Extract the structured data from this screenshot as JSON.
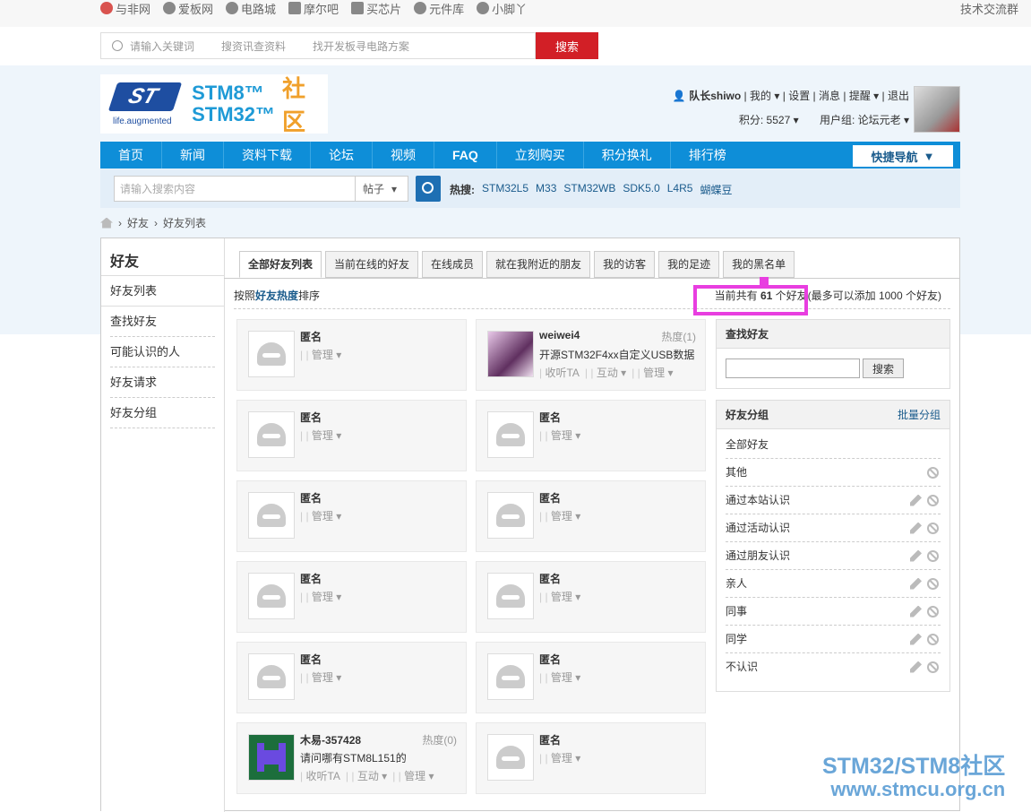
{
  "top_links": [
    "与非网",
    "爱板网",
    "电路城",
    "摩尔吧",
    "买芯片",
    "元件库",
    "小脚丫"
  ],
  "top_right": "技术交流群",
  "search": {
    "placeholders": [
      "请输入关键词",
      "搜资讯查资料",
      "找开发板寻电路方案"
    ],
    "button": "搜索"
  },
  "logo": {
    "tagline": "life.augmented",
    "line1": "STM8™",
    "line2": "STM32™",
    "cn": "社区"
  },
  "user": {
    "name": "队长shiwo",
    "links": [
      "我的",
      "设置",
      "消息",
      "提醒",
      "退出"
    ],
    "points": "积分: 5527",
    "group": "用户组: 论坛元老"
  },
  "nav": {
    "items": [
      "首页",
      "新闻",
      "资料下载",
      "论坛",
      "视频",
      "FAQ",
      "立刻购买",
      "积分换礼",
      "排行榜"
    ],
    "quick": "快捷导航"
  },
  "subsearch": {
    "placeholder": "请输入搜索内容",
    "select": "帖子",
    "hot_label": "热搜:",
    "hot": [
      "STM32L5",
      "M33",
      "STM32WB",
      "SDK5.0",
      "L4R5",
      "蝴蝶豆"
    ]
  },
  "breadcrumb": [
    "好友",
    "好友列表"
  ],
  "sidebar": {
    "title": "好友",
    "items": [
      "好友列表",
      "查找好友",
      "可能认识的人",
      "好友请求",
      "好友分组"
    ]
  },
  "tabs": [
    "全部好友列表",
    "当前在线的好友",
    "在线成员",
    "就在我附近的朋友",
    "我的访客",
    "我的足迹",
    "我的黑名单"
  ],
  "sort": {
    "prefix": "按照",
    "key": "好友热度",
    "suffix": "排序"
  },
  "count": {
    "prefix": "当前共有 ",
    "num": "61",
    "suffix": " 个好友(最多可以添加 1000 个好友)"
  },
  "friends": [
    {
      "name": "匿名",
      "acts": [
        "管理"
      ]
    },
    {
      "name": "weiwei4",
      "heat": "热度(1)",
      "msg": "开源STM32F4xx自定义USB数据",
      "acts": [
        "收听TA",
        "互动",
        "管理"
      ]
    },
    {
      "name": "匿名",
      "acts": [
        "管理"
      ]
    },
    {
      "name": "匿名",
      "acts": [
        "管理"
      ]
    },
    {
      "name": "匿名",
      "acts": [
        "管理"
      ]
    },
    {
      "name": "匿名",
      "acts": [
        "管理"
      ]
    },
    {
      "name": "匿名",
      "acts": [
        "管理"
      ]
    },
    {
      "name": "匿名",
      "acts": [
        "管理"
      ]
    },
    {
      "name": "匿名",
      "acts": [
        "管理"
      ]
    },
    {
      "name": "匿名",
      "acts": [
        "管理"
      ]
    },
    {
      "name": "木易-357428",
      "heat": "热度(0)",
      "msg": "请问哪有STM8L151的",
      "acts": [
        "收听TA",
        "互动",
        "管理"
      ]
    },
    {
      "name": "匿名",
      "acts": [
        "管理"
      ]
    }
  ],
  "find_panel": {
    "title": "查找好友",
    "button": "搜索"
  },
  "group_panel": {
    "title": "好友分组",
    "action": "批量分组",
    "groups": [
      "全部好友",
      "其他",
      "通过本站认识",
      "通过活动认识",
      "通过朋友认识",
      "亲人",
      "同事",
      "同学",
      "不认识"
    ]
  },
  "watermark": {
    "line1": "STM32/STM8社区",
    "line2": "www.stmcu.org.cn"
  }
}
